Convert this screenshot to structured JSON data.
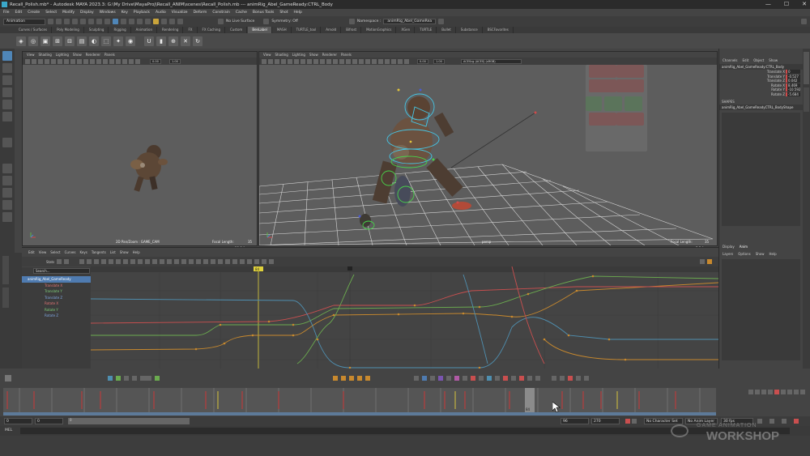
{
  "window": {
    "title": "Recall_Polish.mb* - Autodesk MAYA 2023.3: G:\\My Drive\\MayaProj\\Recall_ANIM\\scenes\\Recall_Polish.mb  ---  animRig_Abel_GameReady:CTRL_Body",
    "controls": [
      "—",
      "☐",
      "✕"
    ]
  },
  "menubar": {
    "items": [
      "File",
      "Edit",
      "Create",
      "Select",
      "Modify",
      "Display",
      "Windows",
      "Key",
      "Playback",
      "Audio",
      "Visualize",
      "Deform",
      "Constrain",
      "Cache",
      "Bonus Tools",
      "Shot",
      "Help"
    ],
    "workspace_label": "Workspace :",
    "workspace_value": "Animation*"
  },
  "status_line": {
    "mode": "Animation",
    "no_live_surface": "No Live Surface",
    "symmetry": "Symmetry: Off",
    "namespace_label": "Namespace :",
    "namespace_value": "animRig_Abel_GameRea"
  },
  "shelf_tabs": [
    "Curves / Surfaces",
    "Poly Modeling",
    "Sculpting",
    "Rigging",
    "Animation",
    "Rendering",
    "FX",
    "FX Caching",
    "Custom",
    "BenLabel",
    "MASH",
    "TURTLE_tool",
    "Arnold",
    "Bifrost",
    "MotionGraphics",
    "XGen",
    "TURTLE",
    "Bullet",
    "Substance",
    "BSCFavorites"
  ],
  "shelf_active_index": 9,
  "viewport_left": {
    "menus": [
      "View",
      "Shading",
      "Lighting",
      "Show",
      "Renderer",
      "Panels"
    ],
    "field_a": "0.00",
    "field_b": "1.00",
    "camera_label": "2D Pan/Zoom : GAME_CAM",
    "focal_label": "Focal Length:",
    "focal_value": "35",
    "fps": "10.9 fps"
  },
  "viewport_right": {
    "menus": [
      "View",
      "Shading",
      "Lighting",
      "Show",
      "Renderer",
      "Panels"
    ],
    "field_a": "0.00",
    "field_b": "1.00",
    "color_space": "ACEScg (ACES) (sRGB)",
    "camera_label": "persp",
    "focal_label": "Focal Length:",
    "focal_value": "35",
    "fps": "5.2 fps"
  },
  "channel_box": {
    "tabs": [
      "Channels",
      "Edit",
      "Object",
      "Show"
    ],
    "object_name": "animRig_Abel_GameReady:CTRL_Body",
    "channels": [
      {
        "name": "Translate X",
        "value": "0"
      },
      {
        "name": "Translate Y",
        "value": "-0.527"
      },
      {
        "name": "Translate Z",
        "value": "0.042"
      },
      {
        "name": "Rotate X",
        "value": "8.469"
      },
      {
        "name": "Rotate Y",
        "value": "-10.592"
      },
      {
        "name": "Rotate Z",
        "value": "-5.684"
      }
    ],
    "shapes_label": "SHAPES",
    "shape_name": "animRig_Abel_GameReadyCTRL_BodyShape"
  },
  "layer_editor": {
    "tabs": [
      "Display",
      "Anim"
    ],
    "menus": [
      "Layers",
      "Options",
      "Show",
      "Help"
    ]
  },
  "graph_editor": {
    "menus": [
      "Edit",
      "View",
      "Select",
      "Curves",
      "Keys",
      "Tangents",
      "List",
      "Show",
      "Help"
    ],
    "stats_label": "Stats",
    "search_placeholder": "Search...",
    "outliner_items": [
      "animRig_Abel_GameReady",
      "Translate X",
      "Translate Y",
      "Translate Z",
      "Rotate X",
      "Rotate Y",
      "Rotate Z"
    ],
    "frame_marker": "84",
    "ruler_marker": "92"
  },
  "time_slider": {
    "current_frame": "84",
    "range_start": "0",
    "range_start2": "0",
    "anim_start": "0",
    "range_end": "96",
    "anim_end": "270",
    "character_set": "No Character Set",
    "anim_layer": "No Anim Layer",
    "fps": "30 fps"
  },
  "command_line": {
    "lang": "MEL"
  },
  "watermark": {
    "line1": "GAME ANIMATION",
    "line2": "WORKSHOP"
  },
  "colors": {
    "curve_red": "#c94f4f",
    "curve_green": "#6bab4f",
    "curve_blue": "#4f8fb0",
    "curve_yellow": "#d6c23c",
    "curve_orange": "#c8892e",
    "current_time": "#e0d23c",
    "key_tick": "#c13a3a"
  }
}
